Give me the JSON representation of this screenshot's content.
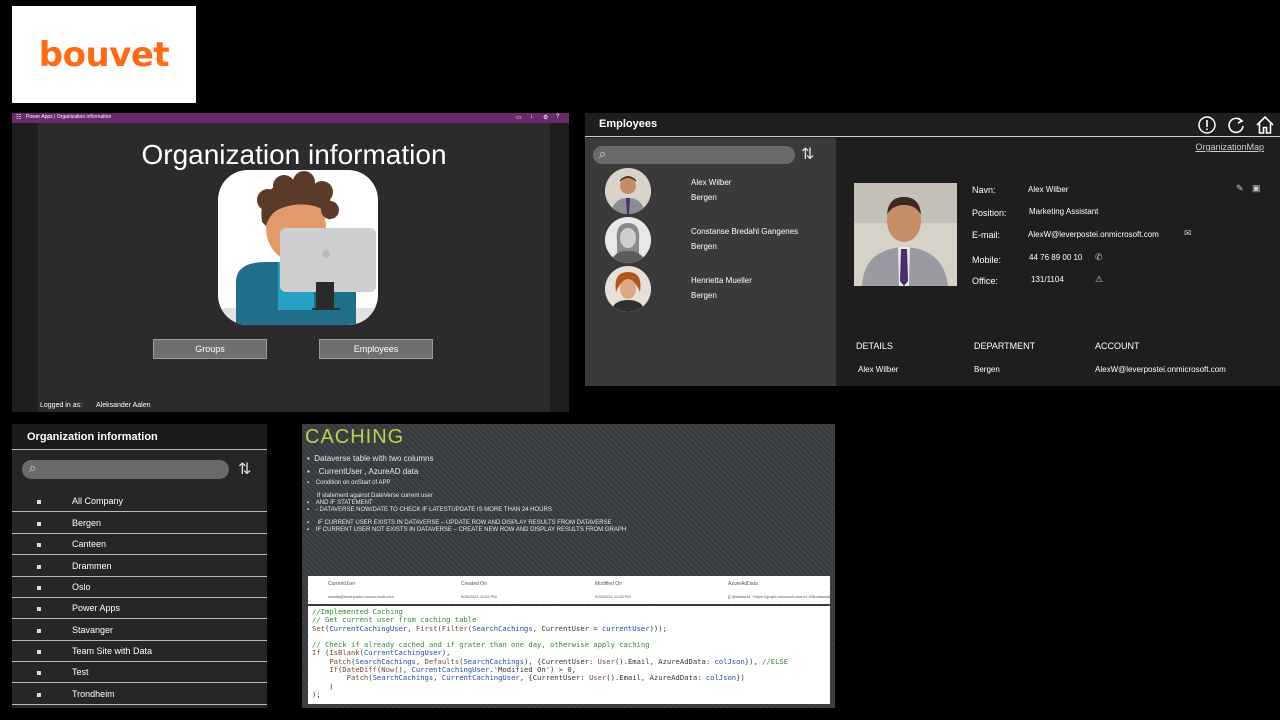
{
  "logo": {
    "text": "bouvet",
    "color": "#ff6a13"
  },
  "org_app": {
    "titlebar": "Power Apps | Organization information",
    "heading": "Organization information",
    "buttons": [
      "Groups",
      "Employees"
    ],
    "logged_in_label": "Logged in as:",
    "logged_in_user": "Aleksander Aalen",
    "titlebar_color": "#6b2a6b"
  },
  "employees_app": {
    "title": "Employees",
    "header_icons": [
      "info-icon",
      "refresh-icon",
      "home-icon"
    ],
    "org_map_link": "OrganizationMap",
    "list": [
      {
        "name": "Alex Wilber",
        "city": "Bergen"
      },
      {
        "name": "Constanse Bredahl Gangenes",
        "city": "Bergen"
      },
      {
        "name": "Henrietta Mueller",
        "city": "Bergen"
      }
    ],
    "detail": {
      "labels": {
        "name": "Navn:",
        "position": "Position:",
        "email": "E-mail:",
        "mobile": "Mobile:",
        "office": "Office:"
      },
      "values": {
        "name": "Alex Wilber",
        "position": "Marketing Assistant",
        "email": "AlexW@leverpostei.onmicrosoft.com",
        "mobile": "44 76 89 00 10",
        "office": "131/1104"
      }
    },
    "table": {
      "headers": [
        "DETAILS",
        "DEPARTMENT",
        "ACCOUNT"
      ],
      "row": [
        "Alex Wilber",
        "Bergen",
        "AlexW@leverpostei.onmicrosoft.com"
      ]
    }
  },
  "groups_app": {
    "title": "Organization information",
    "groups": [
      "All Company",
      "Bergen",
      "Canteen",
      "Drammen",
      "Oslo",
      "Power Apps",
      "Stavanger",
      "Team Site with Data",
      "Test",
      "Trondheim"
    ]
  },
  "caching_slide": {
    "title": "CACHING",
    "title_color": "#b7d44a",
    "bullets": [
      "Dataverse table with two columns",
      "CurrentUser , AzureAD data",
      "Condition on onStart of APP",
      "If statement against DateVerse current user",
      "AND IF STATEMENT",
      "- DATAVERSE NOW/DATE TO CHECK IF LATESTUPDATE IS MORE THAN 24 HOURS",
      "IF CURRENT USER EXISTS IN DATAVERSE – UPDATE ROW AND DISPLAY RESULTS FROM DATAVERSE",
      "IF CURRENT USER NOT EXISTS IN DATAVERSE – CREATE NEW ROW AND DISPLAY RESULTS FROM GRAPH"
    ],
    "table_headers": [
      "CurrentUser",
      "Created On",
      "Modified On",
      "AzureAdData"
    ],
    "table_row": [
      "madita@leverpostei.onmicrosoft.com",
      "9/28/2021 11:03 PM",
      "9/28/2021 11:03 PM",
      "[{\"@odata.id\":\"https://graph.microsoft.com/v1.0/$metadata..."
    ]
  }
}
